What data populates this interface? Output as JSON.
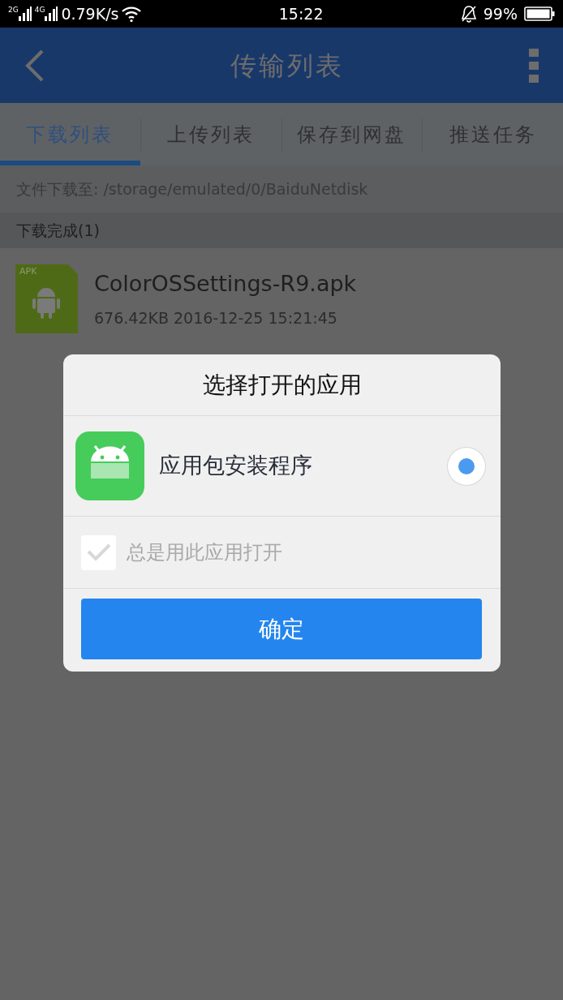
{
  "status_bar": {
    "network_1": "2G",
    "network_2": "4G",
    "speed": "0.79K/s",
    "time": "15:22",
    "battery": "99%"
  },
  "app_bar": {
    "title": "传输列表"
  },
  "tabs": [
    {
      "label": "下载列表",
      "selected": true
    },
    {
      "label": "上传列表",
      "selected": false
    },
    {
      "label": "保存到网盘",
      "selected": false
    },
    {
      "label": "推送任务",
      "selected": false
    }
  ],
  "download_path": "文件下载至: /storage/emulated/0/BaiduNetdisk",
  "section_header": "下载完成(1)",
  "files": [
    {
      "badge": "APK",
      "name": "ColorOSSettings-R9.apk",
      "meta": "676.42KB 2016-12-25 15:21:45"
    }
  ],
  "dialog": {
    "title": "选择打开的应用",
    "apps": [
      {
        "name": "应用包安装程序",
        "selected": true
      }
    ],
    "always_option": {
      "label": "总是用此应用打开",
      "checked": true,
      "disabled": true
    },
    "confirm_button": "确定"
  }
}
